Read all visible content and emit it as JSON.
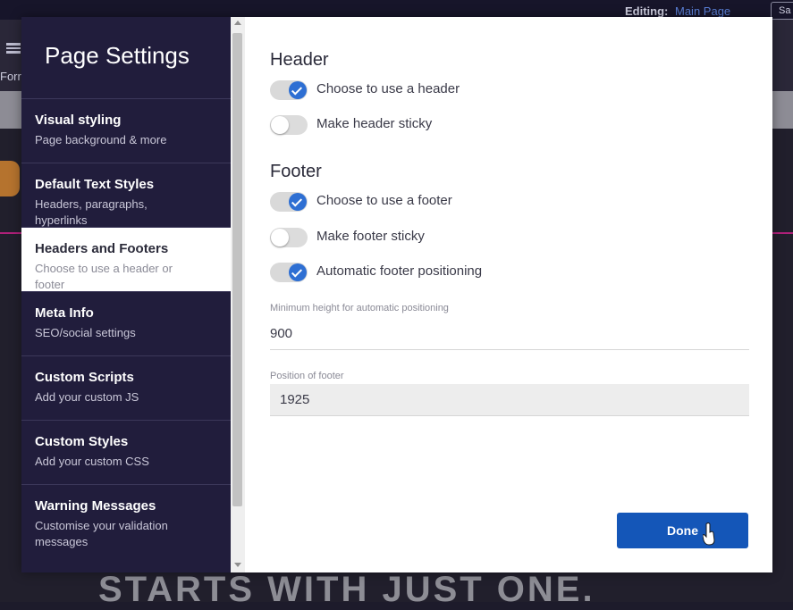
{
  "background": {
    "editing_label": "Editing:",
    "editing_value": "Main Page",
    "save_label": "Sa",
    "toolbar_label": "Forr",
    "headline": "STARTS WITH JUST ONE."
  },
  "modal": {
    "title": "Page Settings",
    "nav": [
      {
        "title": "Visual styling",
        "desc": "Page background & more"
      },
      {
        "title": "Default Text Styles",
        "desc": "Headers, paragraphs, hyperlinks"
      },
      {
        "title": "Headers and Footers",
        "desc": "Choose to use a header or footer"
      },
      {
        "title": "Meta Info",
        "desc": "SEO/social settings"
      },
      {
        "title": "Custom Scripts",
        "desc": "Add your custom JS"
      },
      {
        "title": "Custom Styles",
        "desc": "Add your custom CSS"
      },
      {
        "title": "Warning Messages",
        "desc": "Customise your validation messages"
      }
    ],
    "active_nav": "Headers and Footers",
    "header": {
      "title": "Header",
      "use_header": {
        "label": "Choose to use a header",
        "on": true
      },
      "sticky": {
        "label": "Make header sticky",
        "on": false
      }
    },
    "footer": {
      "title": "Footer",
      "use_footer": {
        "label": "Choose to use a footer",
        "on": true
      },
      "sticky": {
        "label": "Make footer sticky",
        "on": false
      },
      "auto_position": {
        "label": "Automatic footer positioning",
        "on": true
      }
    },
    "min_height": {
      "label": "Minimum height for automatic positioning",
      "value": "900"
    },
    "footer_position": {
      "label": "Position of footer",
      "value": "1925"
    },
    "done_label": "Done"
  },
  "colors": {
    "sidebar_bg": "#211d3c",
    "accent": "#2e6fd3",
    "done_button": "#1456b8"
  }
}
